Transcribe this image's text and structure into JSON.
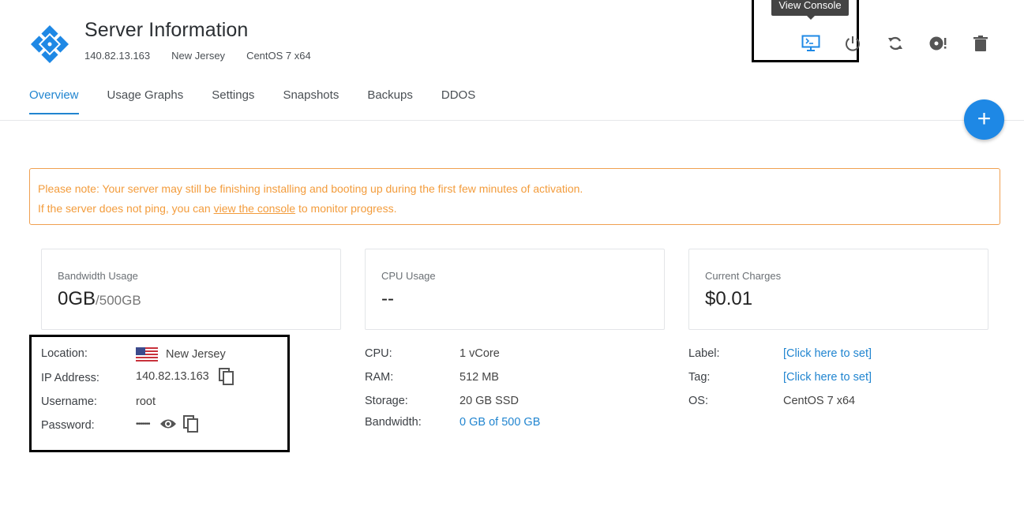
{
  "header": {
    "title": "Server Information",
    "ip": "140.82.13.163",
    "location": "New Jersey",
    "os": "CentOS 7 x64",
    "tooltip": "View Console",
    "corner_fragment": "′ ′ ′"
  },
  "actions": [
    {
      "name": "console-icon"
    },
    {
      "name": "power-icon"
    },
    {
      "name": "restart-icon"
    },
    {
      "name": "reinstall-icon"
    },
    {
      "name": "trash-icon"
    }
  ],
  "tabs": [
    "Overview",
    "Usage Graphs",
    "Settings",
    "Snapshots",
    "Backups",
    "DDOS"
  ],
  "active_tab": "Overview",
  "fab_label": "+",
  "notice": {
    "line1": "Please note: Your server may still be finishing installing and booting up during the first few minutes of activation.",
    "line2_before": "If the server does not ping, you can ",
    "line2_link": "view the console",
    "line2_after": " to monitor progress."
  },
  "cards": {
    "bandwidth": {
      "label": "Bandwidth Usage",
      "value": "0GB",
      "suffix": "/500GB"
    },
    "cpu": {
      "label": "CPU Usage",
      "value": "--"
    },
    "charges": {
      "label": "Current Charges",
      "value": "$0.01"
    }
  },
  "details_left": {
    "location_label": "Location:",
    "location_value": "New Jersey",
    "ip_label": "IP Address:",
    "ip_value": "140.82.13.163",
    "username_label": "Username:",
    "username_value": "root",
    "password_label": "Password:",
    "password_value": "•••••••"
  },
  "details_mid": {
    "cpu_label": "CPU:",
    "cpu_value": "1 vCore",
    "ram_label": "RAM:",
    "ram_value": "512 MB",
    "storage_label": "Storage:",
    "storage_value": "20 GB SSD",
    "bandwidth_label": "Bandwidth:",
    "bandwidth_value": "0 GB of 500 GB"
  },
  "details_right": {
    "label_label": "Label:",
    "label_value": "[Click here to set]",
    "tag_label": "Tag:",
    "tag_value": "[Click here to set]",
    "os_label": "OS:",
    "os_value": "CentOS 7 x64"
  },
  "colors": {
    "accent": "#2185d0",
    "warning": "#f39c3c",
    "fab": "#1e88e5",
    "logo": "#1e88e5"
  }
}
